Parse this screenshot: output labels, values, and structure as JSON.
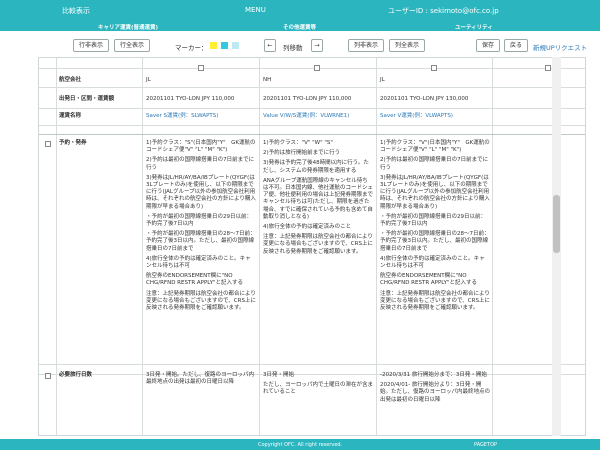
{
  "header": {
    "compare_link": "比較表示",
    "menu": "MENU",
    "user_id": "ユーザーID : sekimoto@ofc.co.jp",
    "sub_career": "キャリア運賃(普通運賃)",
    "sub_fare_compare": "その他運賃等",
    "sub_utility": "ユーティリティ"
  },
  "toolbar": {
    "row_show": "行非表示",
    "row_all_show": "行全表示",
    "marker_label": "マーカー：",
    "col_move": "列移動",
    "col_show": "列非表示",
    "col_all_show": "列全表示",
    "save": "保存",
    "back": "戻る",
    "new_request": "新規UPリクエスト",
    "marker_colors": [
      "#ffee33",
      "#33c7e0",
      "#bfe9f2"
    ]
  },
  "table": {
    "rows": {
      "airline": "航空会社",
      "departure": "出発日・区間・運賃額",
      "fare_name": "運賃名称",
      "booking": "予約・発券",
      "min_stay": "必要旅行日数"
    },
    "columns": [
      {
        "airline": "JL",
        "departure": "20201101 TYO-LON JPY 110,000",
        "fare_name": "Saver S運賃(例：SLWAPTS)",
        "booking": [
          "1)予約クラス：\"S\"(日本国内\"Y\"　GK運航のコードシェア便\"V\" \"L\" \"M\" \"K\")",
          "2)予約は最初の国際線搭乗日の7日前までに行う",
          "3)発券はJL/HR/AY/BA/IBプレート(QYGF(は3Lプレートのみ)を使用し、以下の期限までに行う(JALグループ以外の参加航空会社利用時は、それぞれの航空会社の方針により購入期限が早まる場合あり)",
          "・予約が最初の国際線搭乗日の29日以前：予約完了後7日以内",
          "・予約が最初の国際線搭乗日の28〜7日前：予約完了後3日以内。ただし、最初の国際線搭乗日の7日前まで",
          "4)旅行全体の予約は確定済みのこと。キャンセル待ちは不可",
          "航空券のENDORSEMENT欄に\"NO CHG/RFND RESTR APPLY\"と記入する",
          "注意：上記発券期限は航空会社の都合により変更になる場合もございますので、CRS上に反映される発券期限をご確認願います。"
        ],
        "min_stay": "3日発・開始。ただし、復路のヨーロッパ内最終地点の出発は最初の日曜日以降"
      },
      {
        "airline": "NH",
        "departure": "20201101 TYO-LON JPY 110,000",
        "fare_name": "Value V/W/S運賃(例：VLWRNE1)",
        "booking": [
          "1)予約クラス：\"V\" \"W\" \"S\"",
          "2)予約は旅行開始前までに行う",
          "3)発券は予約完了後48時間以内に行う。ただし、システムの発券期限を適用する",
          "ANAグループ運航国際線のキャンセル待ちは不可。日本国内線、他社運航のコードシェア便、他社便利用の場合は上記発券期限までキャンセル待ちは可(ただし、期限を過ぎた場合、すでに確保されている予約も含めて自動取り消しとなる)",
          "4)旅行全体の予約は確定済みのこと",
          "注意：上記発券期限は航空会社の都合により変更になる場合もございますので、CRS上に反映される発券期限をご確認願います。"
        ],
        "min_stay_1": "3日発・開始",
        "min_stay_2": "ただし、ヨーロッパ内で土曜日の滞在が含まれていること"
      },
      {
        "airline": "JL",
        "departure": "20201101 TYO-LON JPY 130,000",
        "fare_name": "Saver V運賃(例：VLWAPTS)",
        "booking": [
          "1)予約クラス：\"V\"(日本国内\"Y\"　GK運航のコードシェア便\"V\" \"L\" \"M\" \"K\")",
          "2)予約は最初の国際線搭乗日の7日前までに行う",
          "3)発券はJL/HR/AY/BA/IBプレート(QYGF(は3Lプレートのみ)を使用し、以下の期限までに行う(JALグループ以外の参加航空会社利用時は、それぞれの航空会社の方針により購入期限が早まる場合あり)",
          "・予約が最初の国際線搭乗日の29日以前：予約完了後7日以内",
          "・予約が最初の国際線搭乗日の28〜7日前：予約完了後3日以内。ただし、最初の国際線搭乗日の7日前まで",
          "4)旅行全体の予約は確定済みのこと。キャンセル待ちは不可",
          "航空券のENDORSEMENT欄に\"NO CHG/RFND RESTR APPLY\"と記入する",
          "注意：上記発券期限は航空会社の都合により変更になる場合もございますので、CRS上に反映される発券期限をご確認願います。"
        ],
        "min_stay_1": "-2020/3/31 旅行開始分まで：3日発・開始",
        "min_stay_2": "2020/4/01- 旅行開始分より：3日発・開始。ただし、復路のヨーロッパ内最終地点の出発は最初の日曜日以降"
      }
    ]
  },
  "footer": {
    "copyright": "Copyright OFC. All right reserved.",
    "pagetop": "PAGETOP"
  }
}
